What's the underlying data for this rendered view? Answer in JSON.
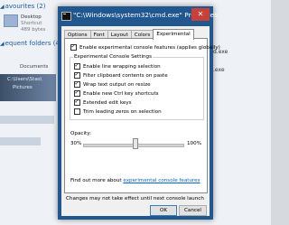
{
  "background": {
    "group1_label": "avourites (2)",
    "group2_label": "equent folders (4)",
    "desktop_item": {
      "name": "Desktop",
      "type": "Shortcut",
      "size": "489 bytes"
    },
    "documents_label": "Documents",
    "path_label": "C:\\Users\\Stas\\",
    "pictures_label": "Pictures",
    "right_file": ".exe",
    "right_file2": "d.exe"
  },
  "dialog": {
    "title": "\"C:\\Windows\\system32\\cmd.exe\" Properties",
    "close_glyph": "✕",
    "tabs": [
      {
        "label": "Options",
        "active": false
      },
      {
        "label": "Font",
        "active": false
      },
      {
        "label": "Layout",
        "active": false
      },
      {
        "label": "Colors",
        "active": false
      },
      {
        "label": "Experimental",
        "active": true
      }
    ],
    "enable_experimental": {
      "label": "Enable experimental console features (applies globally)",
      "checked": true
    },
    "settings_group_label": "Experimental Console Settings",
    "settings": [
      {
        "label": "Enable line wrapping selection",
        "checked": true
      },
      {
        "label": "Filter clipboard contents on paste",
        "checked": true
      },
      {
        "label": "Wrap text output on resize",
        "checked": true
      },
      {
        "label": "Enable new Ctrl key shortcuts",
        "checked": true
      },
      {
        "label": "Extended edit keys",
        "checked": true
      },
      {
        "label": "Trim leading zeros on selection",
        "checked": false
      }
    ],
    "opacity": {
      "label": "Opacity:",
      "min_label": "30%",
      "max_label": "100%",
      "value_fraction": 0.52
    },
    "find_more_prefix": "Find out more about ",
    "find_more_link": "experimental console features",
    "note": "Changes may not take effect until next console launch",
    "ok_label": "OK",
    "cancel_label": "Cancel"
  },
  "colors": {
    "title_bar": "#21578f",
    "close_button": "#c7413a",
    "link": "#0066cc"
  }
}
